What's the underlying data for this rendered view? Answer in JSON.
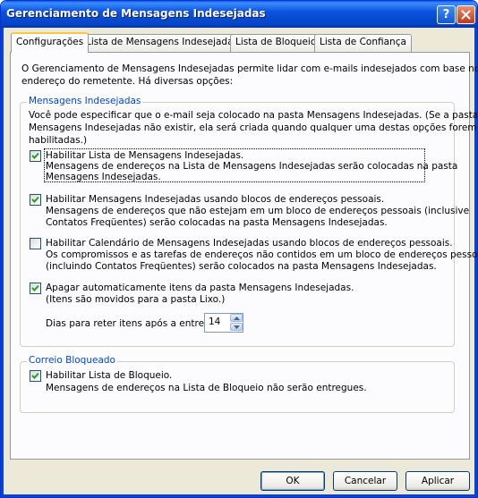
{
  "window": {
    "title": "Gerenciamento de Mensagens Indesejadas",
    "help_button": "?",
    "close_button": "✕"
  },
  "tabs": [
    {
      "label": "Configurações",
      "active": true
    },
    {
      "label": "Lista de Mensagens Indesejadas",
      "active": false
    },
    {
      "label": "Lista de Bloqueio",
      "active": false
    },
    {
      "label": "Lista de Confiança",
      "active": false
    }
  ],
  "intro": {
    "line1": "O Gerenciamento de Mensagens Indesejadas permite lidar com e-mails indesejados com base no",
    "line2": "endereço do remetente. Há diversas opções:"
  },
  "junk_group": {
    "legend": "Mensagens Indesejadas",
    "desc_line1": "Você pode especificar que o e-mail seja colocado na pasta Mensagens Indesejadas. (Se a pasta",
    "desc_line2": "Mensagens Indesejadas não existir, ela será criada quando qualquer uma destas opções forem",
    "desc_line3": "habilitadas.)",
    "options": [
      {
        "checked": true,
        "label_line1": "Habilitar Lista de Mensagens Indesejadas.",
        "label_line2": "Mensagens de endereços na Lista de Mensagens Indesejadas serão colocadas na pasta",
        "label_line3": "Mensagens Indesejadas."
      },
      {
        "checked": true,
        "label_line1": "Habilitar Mensagens Indesejadas usando blocos de endereços pessoais.",
        "label_line2": "Mensagens de endereços que não estejam em um bloco de endereços pessoais (inclusive",
        "label_line3": "Contatos Freqüentes) serão colocadas na pasta Mensagens Indesejadas."
      },
      {
        "checked": false,
        "label_line1": "Habilitar Calendário de Mensagens Indesejadas usando blocos de endereços pessoais.",
        "label_line2": "Os compromissos e as tarefas de endereços não contidos em um bloco de endereços pessoal",
        "label_line3": "(incluindo Contatos Freqüentes) serão colocados na pasta Mensagens Indesejadas."
      },
      {
        "checked": true,
        "label_line1": "Apagar automaticamente itens da pasta Mensagens Indesejadas.",
        "label_line2": "(Itens são movidos para a pasta Lixo.)"
      }
    ],
    "retain_label": "Dias para reter itens após a entrega:",
    "retain_days": "14"
  },
  "blocked_group": {
    "legend": "Correio Bloqueado",
    "option": {
      "checked": true,
      "label_line1": "Habilitar Lista de Bloqueio.",
      "label_line2": "Mensagens de endereços na Lista de Bloqueio não serão entregues."
    }
  },
  "buttons": {
    "ok": "OK",
    "cancel": "Cancelar",
    "apply": "Aplicar"
  }
}
